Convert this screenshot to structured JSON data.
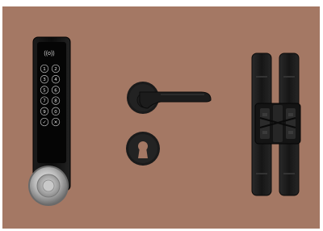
{
  "scene": {
    "background_color": "#a47864",
    "products": [
      {
        "name": "digital-keypad-door-lock",
        "color": "#111111"
      },
      {
        "name": "lever-door-handle",
        "color": "#1a1a1a"
      },
      {
        "name": "escutcheon-key-hole",
        "color": "#1a1a1a"
      },
      {
        "name": "concealed-3d-hinge",
        "color": "#1b1b1b"
      }
    ],
    "keypad": {
      "icon": "((o))",
      "keys": [
        "1",
        "2",
        "3",
        "4",
        "5",
        "6",
        "7",
        "8",
        "9",
        "0",
        "✓",
        "✕"
      ]
    }
  }
}
